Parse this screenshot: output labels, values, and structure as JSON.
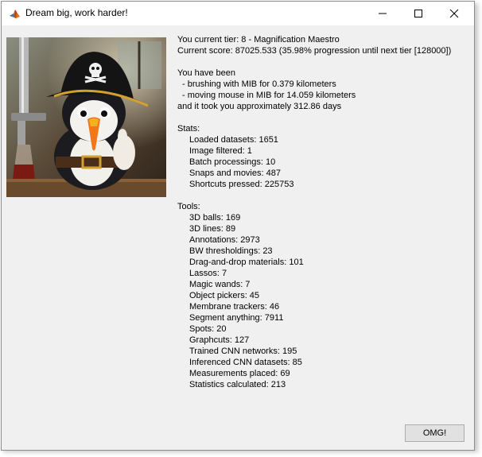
{
  "window": {
    "title": "Dream big, work harder!",
    "icon": "matlab-icon"
  },
  "tier_line": "You current tier: 8 - Magnification Maestro",
  "score_line": "Current score: 87025.533 (35.98% progression until next tier [128000])",
  "activity": {
    "intro": "You have been",
    "brushing": "- brushing with MIB for 0.379 kilometers",
    "mouse": "- moving mouse in MIB for 14.059 kilometers",
    "duration": "and it took you approximately 312.86 days"
  },
  "stats": {
    "heading": "Stats:",
    "items": [
      "Loaded datasets: 1651",
      "Image filtered: 1",
      "Batch processings: 10",
      "Snaps and movies: 487",
      "Shortcuts pressed: 225753"
    ]
  },
  "tools": {
    "heading": "Tools:",
    "items": [
      "3D balls: 169",
      "3D lines: 89",
      "Annotations: 2973",
      "BW thresholdings: 23",
      "Drag-and-drop materials: 101",
      "Lassos: 7",
      "Magic wands: 7",
      "Object pickers: 45",
      "Membrane trackers: 46",
      "Segment anything: 7911",
      "Spots: 20",
      "Graphcuts: 127",
      "Trained CNN networks: 195",
      "Inferenced CNN datasets: 85",
      "Measurements placed: 69",
      "Statistics calculated: 213"
    ]
  },
  "button": {
    "label": "OMG!"
  }
}
